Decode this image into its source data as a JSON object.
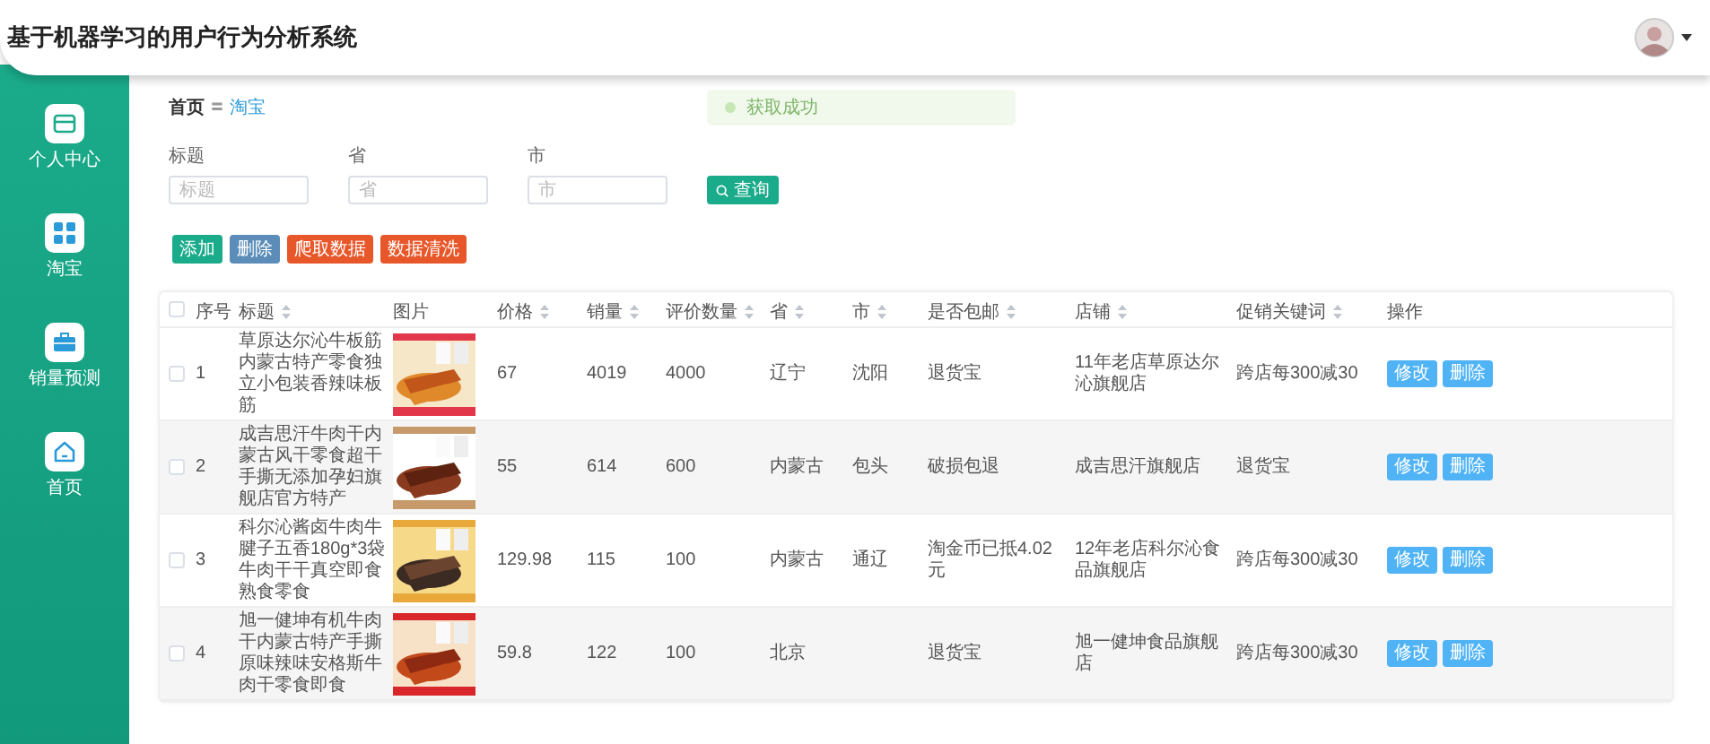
{
  "header": {
    "title": "基于机器学习的用户行为分析系统"
  },
  "sidebar": {
    "items": [
      {
        "label": "个人中心"
      },
      {
        "label": "淘宝"
      },
      {
        "label": "销量预测"
      },
      {
        "label": "首页"
      }
    ]
  },
  "breadcrumb": {
    "home": "首页",
    "separator": "〓",
    "current": "淘宝"
  },
  "message": {
    "text": "获取成功"
  },
  "filters": [
    {
      "label": "标题",
      "placeholder": "标题"
    },
    {
      "label": "省",
      "placeholder": "省"
    },
    {
      "label": "市",
      "placeholder": "市"
    }
  ],
  "search_button": "查询",
  "actions": [
    {
      "label": "添加",
      "color": "#1aab8a"
    },
    {
      "label": "删除",
      "color": "#5b8db8"
    },
    {
      "label": "爬取数据",
      "color": "#e8572a"
    },
    {
      "label": "数据清洗",
      "color": "#e8572a"
    }
  ],
  "table": {
    "select_all": {
      "checked": false
    },
    "columns": [
      {
        "label": "序号",
        "sortable": false
      },
      {
        "label": "标题",
        "sortable": true
      },
      {
        "label": "图片",
        "sortable": false
      },
      {
        "label": "价格",
        "sortable": true
      },
      {
        "label": "销量",
        "sortable": true
      },
      {
        "label": "评价数量",
        "sortable": true
      },
      {
        "label": "省",
        "sortable": true
      },
      {
        "label": "市",
        "sortable": true
      },
      {
        "label": "是否包邮",
        "sortable": true
      },
      {
        "label": "店铺",
        "sortable": true
      },
      {
        "label": "促销关键词",
        "sortable": true
      },
      {
        "label": "操作",
        "sortable": false
      }
    ],
    "rows": [
      {
        "checked": false,
        "cells": [
          "1",
          "草原达尔沁牛板筋内蒙古特产零食独立小包装香辣味板筋",
          {
            "kind": "picture"
          },
          "67",
          "4019",
          "4000",
          "辽宁",
          "沈阳",
          "退货宝",
          "11年老店草原达尔沁旗舰店",
          "跨店每300减30"
        ],
        "buttons": [
          "修改",
          "删除"
        ]
      },
      {
        "checked": false,
        "cells": [
          "2",
          "成吉思汗牛肉干内蒙古风干零食超干手撕无添加孕妇旗舰店官方特产",
          {
            "kind": "picture"
          },
          "55",
          "614",
          "600",
          "内蒙古",
          "包头",
          "破损包退",
          "成吉思汗旗舰店",
          "退货宝"
        ],
        "buttons": [
          "修改",
          "删除"
        ]
      },
      {
        "checked": false,
        "cells": [
          "3",
          "科尔沁酱卤牛肉牛腱子五香180g*3袋牛肉干干真空即食熟食零食",
          {
            "kind": "picture"
          },
          "129.98",
          "115",
          "100",
          "内蒙古",
          "通辽",
          "淘金币已抵4.02元",
          "12年老店科尔沁食品旗舰店",
          "跨店每300减30"
        ],
        "buttons": [
          "修改",
          "删除"
        ]
      },
      {
        "checked": false,
        "cells": [
          "4",
          "旭一健坤有机牛肉干内蒙古特产手撕原味辣味安格斯牛肉干零食即食",
          {
            "kind": "picture"
          },
          "59.8",
          "122",
          "100",
          "北京",
          null,
          "退货宝",
          "旭一健坤食品旗舰店",
          "跨店每300减30"
        ],
        "buttons": [
          "修改",
          "删除"
        ]
      }
    ]
  }
}
